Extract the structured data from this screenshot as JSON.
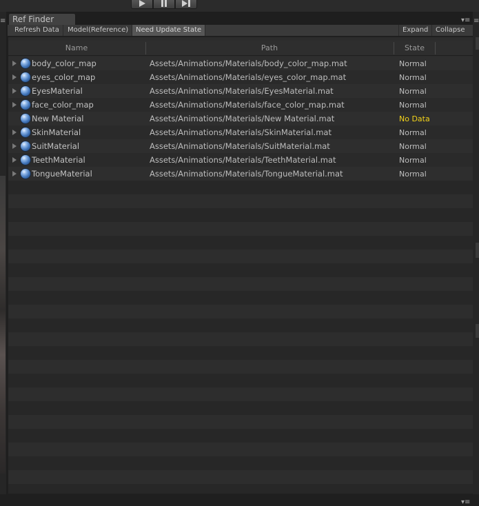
{
  "window": {
    "tab_title": "Ref Finder"
  },
  "toolbar": {
    "refresh_label": "Refresh Data",
    "model_label": "Model(Reference)",
    "need_update_label": "Need Update State",
    "expand_label": "Expand",
    "collapse_label": "Collapse"
  },
  "columns": {
    "name": "Name",
    "path": "Path",
    "state": "State"
  },
  "rows": [
    {
      "name": "body_color_map",
      "path": "Assets/Animations/Materials/body_color_map.mat",
      "state": "Normal",
      "expandable": true
    },
    {
      "name": "eyes_color_map",
      "path": "Assets/Animations/Materials/eyes_color_map.mat",
      "state": "Normal",
      "expandable": true
    },
    {
      "name": "EyesMaterial",
      "path": "Assets/Animations/Materials/EyesMaterial.mat",
      "state": "Normal",
      "expandable": true
    },
    {
      "name": "face_color_map",
      "path": "Assets/Animations/Materials/face_color_map.mat",
      "state": "Normal",
      "expandable": true
    },
    {
      "name": "New Material",
      "path": "Assets/Animations/Materials/New Material.mat",
      "state": "No Data",
      "expandable": false
    },
    {
      "name": "SkinMaterial",
      "path": "Assets/Animations/Materials/SkinMaterial.mat",
      "state": "Normal",
      "expandable": true
    },
    {
      "name": "SuitMaterial",
      "path": "Assets/Animations/Materials/SuitMaterial.mat",
      "state": "Normal",
      "expandable": true
    },
    {
      "name": "TeethMaterial",
      "path": "Assets/Animations/Materials/TeethMaterial.mat",
      "state": "Normal",
      "expandable": true
    },
    {
      "name": "TongueMaterial",
      "path": "Assets/Animations/Materials/TongueMaterial.mat",
      "state": "Normal",
      "expandable": true
    }
  ],
  "icons": {
    "row_icon": "material-sphere-icon",
    "menu": "context-menu-icon",
    "play": "play-icon",
    "pause": "pause-icon",
    "step": "step-icon"
  },
  "colors": {
    "no_data_state": "#f2d21a",
    "active_toolbar_button": "#565656"
  }
}
